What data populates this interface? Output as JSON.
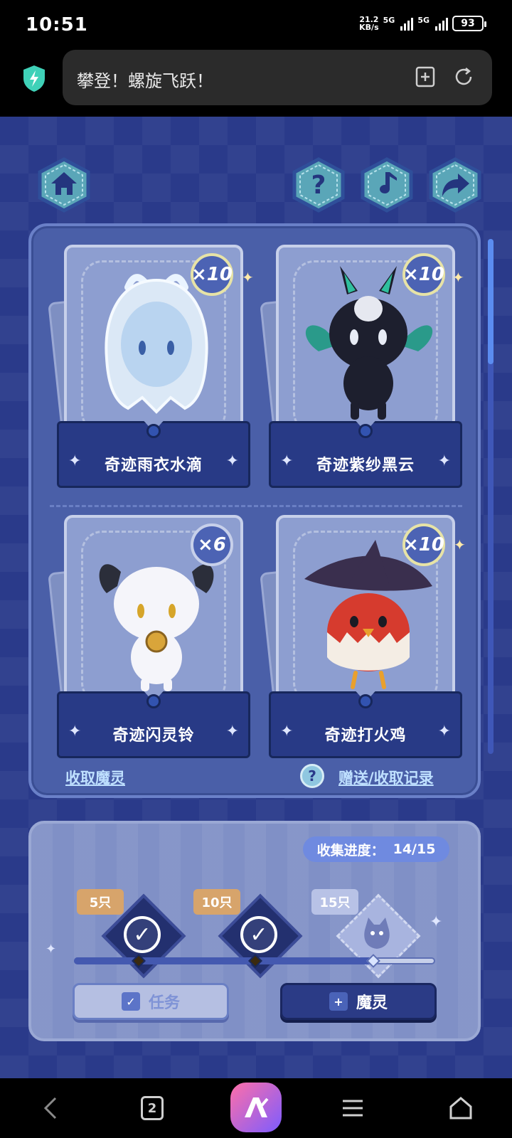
{
  "status_bar": {
    "time": "10:51",
    "net_speed_value": "21.2",
    "net_speed_unit": "KB/s",
    "sim1_label": "5G",
    "sim2_label": "5G",
    "battery": "93"
  },
  "browser": {
    "page_title": "攀登！螺旋飞跃！",
    "icons": [
      "shield-icon",
      "bookmark-add-icon",
      "reload-icon"
    ]
  },
  "toolbar_icons": [
    "home-icon",
    "help-icon",
    "music-icon",
    "share-icon"
  ],
  "cards": [
    {
      "name": "奇迹雨衣水滴",
      "count": "×10"
    },
    {
      "name": "奇迹紫纱黑云",
      "count": "×10"
    },
    {
      "name": "奇迹闪灵铃",
      "count": "×6"
    },
    {
      "name": "奇迹打火鸡",
      "count": "×10"
    }
  ],
  "links": {
    "collect": "收取魔灵",
    "history": "赠送/收取记录"
  },
  "progress": {
    "label": "收集进度：",
    "value": "14/15",
    "collected": 14,
    "total": 15,
    "milestones": [
      {
        "label": "5只",
        "claimed": true
      },
      {
        "label": "10只",
        "claimed": true
      },
      {
        "label": "15只",
        "claimed": false
      }
    ]
  },
  "buttons": {
    "task": "任务",
    "spirit": "魔灵"
  },
  "nav": {
    "tab_count": "2"
  },
  "colors": {
    "game_bg": "#2a3a8a",
    "panel": "#4a5fa8",
    "link": "#bfe0ff",
    "badge_gold": "#e7e3a6"
  }
}
